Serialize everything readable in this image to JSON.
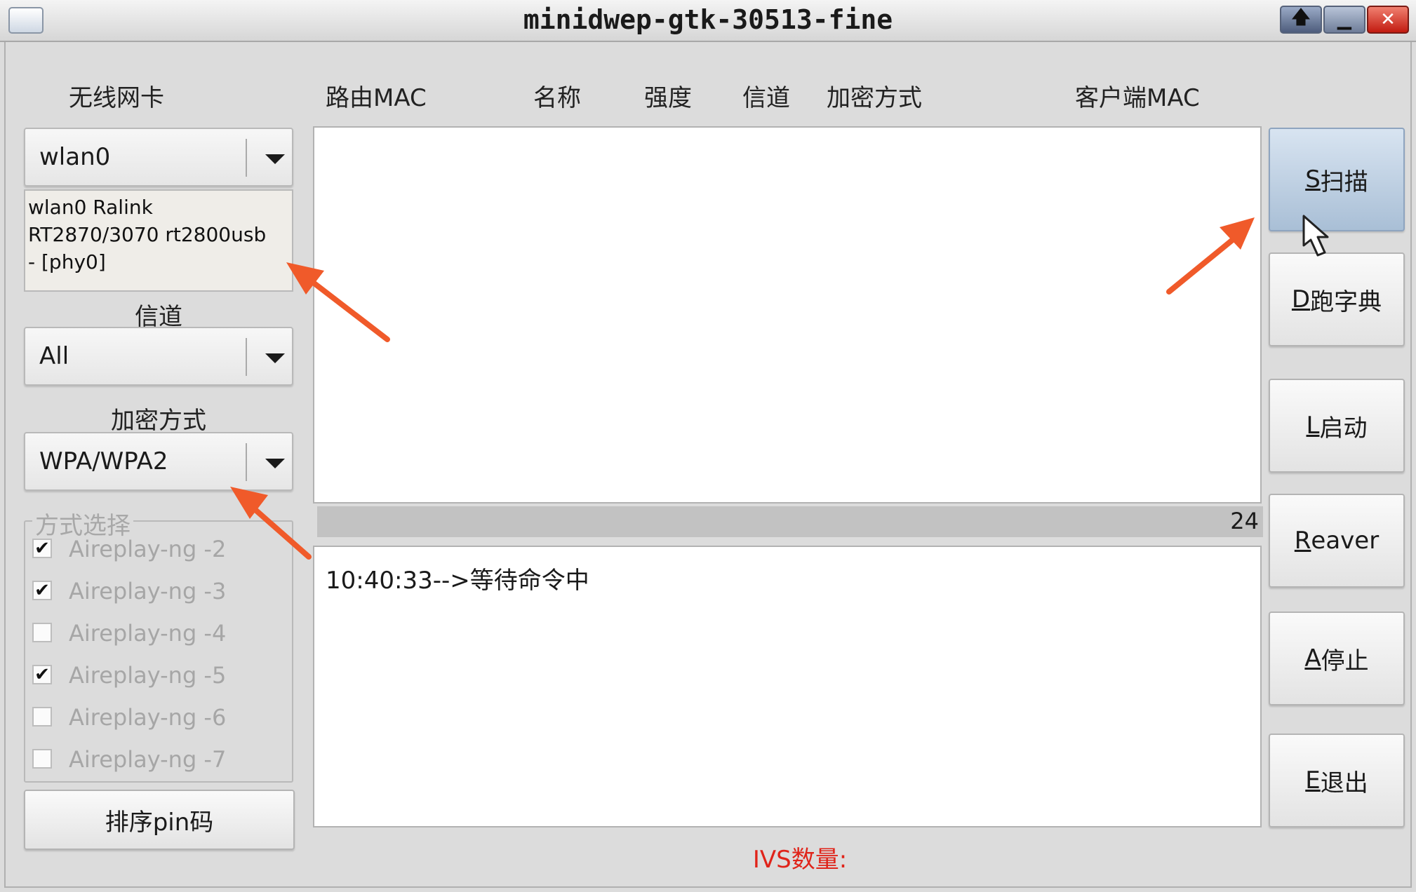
{
  "window": {
    "title": "minidwep-gtk-30513-fine",
    "controls": {
      "maximize": "🡅",
      "minimize": "▁",
      "close": "✕"
    }
  },
  "columns": {
    "wireless_card": "无线网卡",
    "router_mac": "路由MAC",
    "name": "名称",
    "strength": "强度",
    "channel": "信道",
    "encryption": "加密方式",
    "client_mac": "客户端MAC"
  },
  "left": {
    "interface": {
      "selected": "wlan0"
    },
    "interface_info": [
      "wlan0 Ralink",
      "RT2870/3070 rt2800usb",
      "- [phy0]"
    ],
    "channel_label": "信道",
    "channel": {
      "selected": "All"
    },
    "encryption_label": "加密方式",
    "encryption": {
      "selected": "WPA/WPA2"
    },
    "mode_group": {
      "title": "方式选择",
      "options": [
        {
          "label": "Aireplay-ng -2",
          "checked": true,
          "mark": "✔"
        },
        {
          "label": "Aireplay-ng -3",
          "checked": true,
          "mark": "✔"
        },
        {
          "label": "Aireplay-ng -4",
          "checked": false,
          "mark": ""
        },
        {
          "label": "Aireplay-ng -5",
          "checked": true,
          "mark": "✔"
        },
        {
          "label": "Aireplay-ng -6",
          "checked": false,
          "mark": ""
        },
        {
          "label": "Aireplay-ng -7",
          "checked": false,
          "mark": ""
        }
      ]
    },
    "sort_pin_button": "排序pin码"
  },
  "progress": {
    "value": "24"
  },
  "log": {
    "line": "10:40:33-->等待命令中"
  },
  "ivs_label": "IVS数量:",
  "buttons": {
    "scan": {
      "accel": "S",
      "rest": "扫描"
    },
    "dict": {
      "accel": "D",
      "rest": "跑字典"
    },
    "launch": {
      "accel": "L",
      "rest": "启动"
    },
    "reaver": {
      "accel": "R",
      "rest": "eaver"
    },
    "stop": {
      "accel": "A",
      "rest": "停止"
    },
    "exit": {
      "accel": "E",
      "rest": "退出"
    }
  },
  "colors": {
    "annotation_arrow": "#f05a2a",
    "ivs_text": "#e0241a",
    "hover_button": "#b8cbe0"
  }
}
